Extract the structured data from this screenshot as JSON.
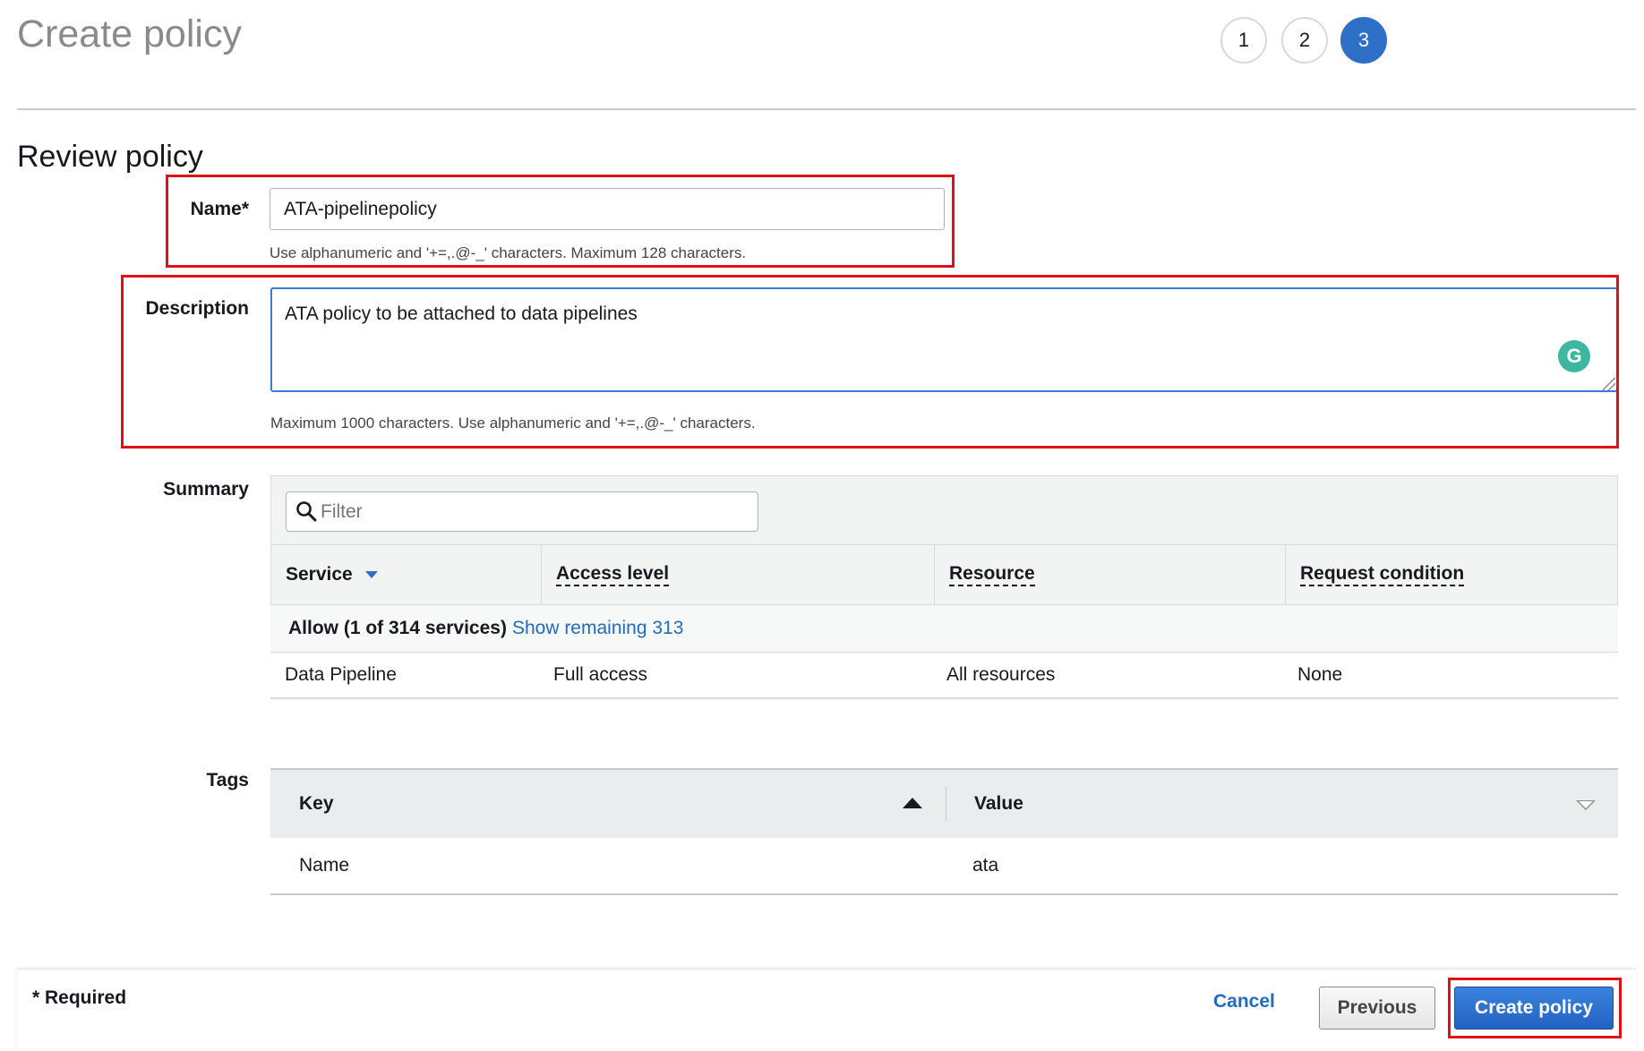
{
  "page": {
    "title": "Create policy",
    "steps": [
      "1",
      "2",
      "3"
    ],
    "active_step": "3",
    "section_title": "Review policy"
  },
  "form": {
    "name_label": "Name*",
    "name_value": "ATA-pipelinepolicy",
    "name_hint": "Use alphanumeric and '+=,.@-_' characters. Maximum 128 characters.",
    "description_label": "Description",
    "description_value": "ATA policy to be attached to data pipelines",
    "description_hint": "Maximum 1000 characters. Use alphanumeric and '+=,.@-_' characters."
  },
  "summary": {
    "label": "Summary",
    "filter_placeholder": "Filter",
    "columns": [
      "Service",
      "Access level",
      "Resource",
      "Request condition"
    ],
    "allow_text": "Allow (1 of 314 services)",
    "show_remaining_link": "Show remaining 313",
    "rows": [
      {
        "service": "Data Pipeline",
        "access_level": "Full access",
        "resource": "All resources",
        "request_condition": "None"
      }
    ]
  },
  "tags": {
    "label": "Tags",
    "columns": [
      "Key",
      "Value"
    ],
    "rows": [
      {
        "key": "Name",
        "value": "ata"
      }
    ]
  },
  "footer": {
    "required_note": "* Required",
    "cancel_label": "Cancel",
    "previous_label": "Previous",
    "create_label": "Create policy"
  },
  "colors": {
    "primary_blue": "#2e6fc8",
    "link_blue": "#1f6bc1",
    "highlight_red": "#e0101a",
    "grammarly_green": "#3db8a0"
  },
  "icons": [
    "search-icon",
    "caret-down-icon",
    "sort-up-icon",
    "settings-caret-icon",
    "grammarly-icon"
  ]
}
